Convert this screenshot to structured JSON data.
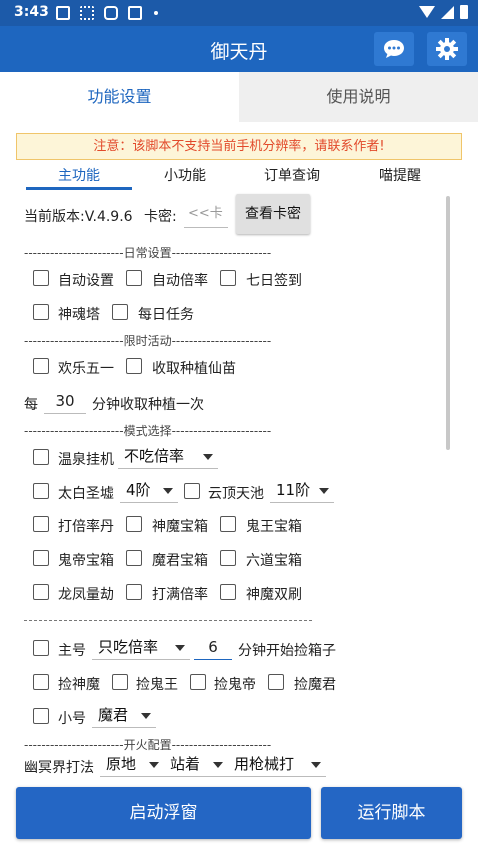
{
  "status_bar": {
    "time": "3:43"
  },
  "app": {
    "title": "御天丹"
  },
  "tabs": [
    "功能设置",
    "使用说明"
  ],
  "notice": "注意：该脚本不支持当前手机分辨率，请联系作者!",
  "subtabs": [
    "主功能",
    "小功能",
    "订单查询",
    "喵提醒"
  ],
  "version": {
    "label": "当前版本:V.4.9.6",
    "key_label": "卡密:",
    "key_placeholder": "<<卡",
    "check_button": "查看卡密"
  },
  "sections": {
    "daily": "-----------------------日常设置-----------------------",
    "limited": "-----------------------限时活动-----------------------",
    "mode": "-----------------------模式选择-----------------------",
    "fire": "-----------------------开火配置-----------------------"
  },
  "daily": [
    "自动设置",
    "自动倍率",
    "七日签到",
    "神魂塔",
    "每日任务"
  ],
  "limited": [
    "欢乐五一",
    "收取种植仙苗"
  ],
  "harvest": {
    "prefix": "每",
    "value": "30",
    "suffix": "分钟收取种植一次"
  },
  "mode": {
    "hot_spring": "温泉挂机",
    "hot_spring_option": "不吃倍率",
    "taibai": "太白圣墟",
    "taibai_option": "4阶",
    "yunding": "云顶天池",
    "yunding_option": "11阶",
    "items": [
      "打倍率丹",
      "神魔宝箱",
      "鬼王宝箱",
      "鬼帝宝箱",
      "魔君宝箱",
      "六道宝箱",
      "龙凤量劫",
      "打满倍率",
      "神魔双刷"
    ]
  },
  "main_account": {
    "label": "主号",
    "option": "只吃倍率",
    "minutes": "6",
    "suffix": "分钟开始捡箱子"
  },
  "pick": [
    "捡神魔",
    "捡鬼王",
    "捡鬼帝",
    "捡魔君"
  ],
  "alt_account": {
    "label": "小号",
    "option": "魔君"
  },
  "fire": {
    "label": "幽冥界打法",
    "options": [
      "原地",
      "站着",
      "用枪械打"
    ]
  },
  "buttons": {
    "float": "启动浮窗",
    "run": "运行脚本"
  }
}
